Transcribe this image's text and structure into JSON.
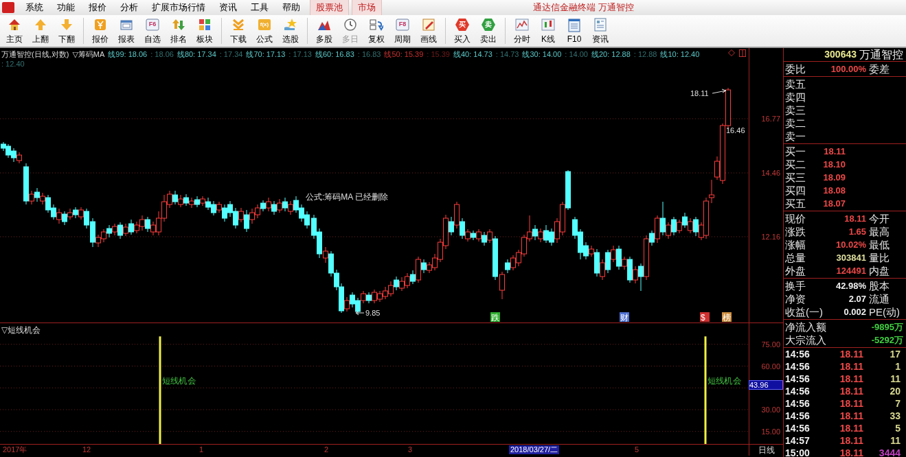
{
  "menu": {
    "items": [
      "系统",
      "功能",
      "报价",
      "分析",
      "扩展市场行情",
      "资讯",
      "工具",
      "帮助"
    ],
    "tabs": [
      {
        "label": "股票池"
      },
      {
        "label": "市场"
      }
    ],
    "title": "通达信金融终端 万通智控"
  },
  "toolbar": [
    [
      {
        "label": "主页",
        "disabled": false
      },
      {
        "label": "上翻",
        "disabled": false
      },
      {
        "label": "下翻",
        "disabled": false
      }
    ],
    [
      {
        "label": "报价",
        "disabled": false
      },
      {
        "label": "报表",
        "disabled": false
      },
      {
        "label": "自选",
        "badge": "F6",
        "disabled": false
      },
      {
        "label": "排名",
        "disabled": false
      },
      {
        "label": "板块",
        "disabled": false
      }
    ],
    [
      {
        "label": "下载",
        "disabled": false
      },
      {
        "label": "公式",
        "badge": "f(x)",
        "disabled": false
      },
      {
        "label": "选股",
        "disabled": false
      }
    ],
    [
      {
        "label": "多股",
        "disabled": false
      },
      {
        "label": "多日",
        "disabled": true
      },
      {
        "label": "复权",
        "disabled": false
      },
      {
        "label": "周期",
        "badge": "F8",
        "disabled": false
      },
      {
        "label": "画线",
        "disabled": false
      }
    ],
    [
      {
        "label": "买入",
        "badge": "买",
        "disabled": false
      },
      {
        "label": "卖出",
        "badge": "卖",
        "disabled": false
      }
    ],
    [
      {
        "label": "分时",
        "disabled": false
      },
      {
        "label": "K线",
        "disabled": false
      },
      {
        "label": "F10",
        "disabled": false
      },
      {
        "label": "资讯",
        "disabled": false
      }
    ]
  ],
  "chart": {
    "title": "万通智控(日线,对数)",
    "indicator": "▽筹码MA",
    "ma": [
      {
        "label": "线99: 18.06",
        "echo": ": 18.06",
        "color": "#5cc8c8"
      },
      {
        "label": "线80: 17.34",
        "echo": ": 17.34",
        "color": "#5cc8c8"
      },
      {
        "label": "线70: 17.13",
        "echo": ": 17.13",
        "color": "#5cc8c8"
      },
      {
        "label": "线60: 16.83",
        "echo": ": 16.83",
        "color": "#5cc8c8"
      },
      {
        "label": "线50: 15.39",
        "echo": ": 15.39",
        "color": "#c83030"
      },
      {
        "label": "线40: 14.73",
        "echo": ": 14.73",
        "color": "#5cc8c8"
      },
      {
        "label": "线30: 14.00",
        "echo": ": 14.00",
        "color": "#5cc8c8"
      },
      {
        "label": "线20: 12.88",
        "echo": ": 12.88",
        "color": "#5cc8c8"
      },
      {
        "label": "线10: 12.40",
        "echo": ": 12.40",
        "color": "#5cc8c8"
      }
    ],
    "yaxis": [
      "16.77",
      "14.46",
      "12.16"
    ],
    "annotations": [
      {
        "kind": "high",
        "text": "18.11"
      },
      {
        "kind": "price",
        "text": "16.46"
      },
      {
        "kind": "low",
        "text": "9.85"
      },
      {
        "kind": "note",
        "text": "公式:筹码MA 已经删除"
      }
    ],
    "events": [
      {
        "text": "跌",
        "color": "#30b030"
      },
      {
        "text": "财",
        "color": "#5070d0"
      },
      {
        "text": "$",
        "color": "#d03030"
      },
      {
        "text": "榜",
        "color": "#d09040"
      }
    ]
  },
  "indicator": {
    "title": "▽短线机会",
    "signals": [
      {
        "text": "短线机会"
      },
      {
        "text": "短线机会"
      }
    ],
    "yaxis": [
      "75.00",
      "60.00",
      "30.00",
      "15.00"
    ],
    "current": "43.96"
  },
  "dates": [
    {
      "label": "2017年",
      "selected": false
    },
    {
      "label": "12",
      "selected": false
    },
    {
      "label": "1",
      "selected": false
    },
    {
      "label": "2",
      "selected": false
    },
    {
      "label": "3",
      "selected": false
    },
    {
      "label": "2018/03/27/二",
      "selected": true
    },
    {
      "label": "5",
      "selected": false
    }
  ],
  "period": "日线",
  "quote": {
    "code": "300643",
    "name": "万通智控",
    "ratio": {
      "label": "委比",
      "value": "100.00%",
      "extra": "委差"
    },
    "asks": [
      {
        "label": "卖五"
      },
      {
        "label": "卖四"
      },
      {
        "label": "卖三"
      },
      {
        "label": "卖二"
      },
      {
        "label": "卖一"
      }
    ],
    "bids": [
      {
        "label": "买一",
        "price": "18.11"
      },
      {
        "label": "买二",
        "price": "18.10"
      },
      {
        "label": "买三",
        "price": "18.09"
      },
      {
        "label": "买四",
        "price": "18.08"
      },
      {
        "label": "买五",
        "price": "18.07"
      }
    ],
    "stats": [
      {
        "label": "现价",
        "value": "18.11",
        "label2": "今开"
      },
      {
        "label": "涨跌",
        "value": "1.65",
        "label2": "最高"
      },
      {
        "label": "涨幅",
        "value": "10.02%",
        "label2": "最低"
      },
      {
        "label": "总量",
        "value": "303841",
        "label2": "量比"
      },
      {
        "label": "外盘",
        "value": "124491",
        "label2": "内盘"
      }
    ],
    "stats2": [
      {
        "label": "换手",
        "value": "42.98%",
        "label2": "股本"
      },
      {
        "label": "净资",
        "value": "2.07",
        "label2": "流通"
      },
      {
        "label": "收益(一)",
        "value": "0.002",
        "label2": "PE(动)"
      }
    ],
    "flows": [
      {
        "label": "净流入额",
        "value": "-9895万"
      },
      {
        "label": "大宗流入",
        "value": "-5292万"
      }
    ],
    "ticks": [
      {
        "time": "14:56",
        "price": "18.11",
        "volume": "17",
        "color": "#d8d890"
      },
      {
        "time": "14:56",
        "price": "18.11",
        "volume": "1",
        "color": "#d8d890"
      },
      {
        "time": "14:56",
        "price": "18.11",
        "volume": "11",
        "color": "#d8d890"
      },
      {
        "time": "14:56",
        "price": "18.11",
        "volume": "20",
        "color": "#d8d890"
      },
      {
        "time": "14:56",
        "price": "18.11",
        "volume": "7",
        "color": "#d8d890"
      },
      {
        "time": "14:56",
        "price": "18.11",
        "volume": "33",
        "color": "#d8d890"
      },
      {
        "time": "14:56",
        "price": "18.11",
        "volume": "5",
        "color": "#d8d890"
      },
      {
        "time": "14:57",
        "price": "18.11",
        "volume": "11",
        "color": "#d8d890"
      },
      {
        "time": "15:00",
        "price": "18.11",
        "volume": "3444",
        "color": "#c040c0"
      }
    ]
  }
}
